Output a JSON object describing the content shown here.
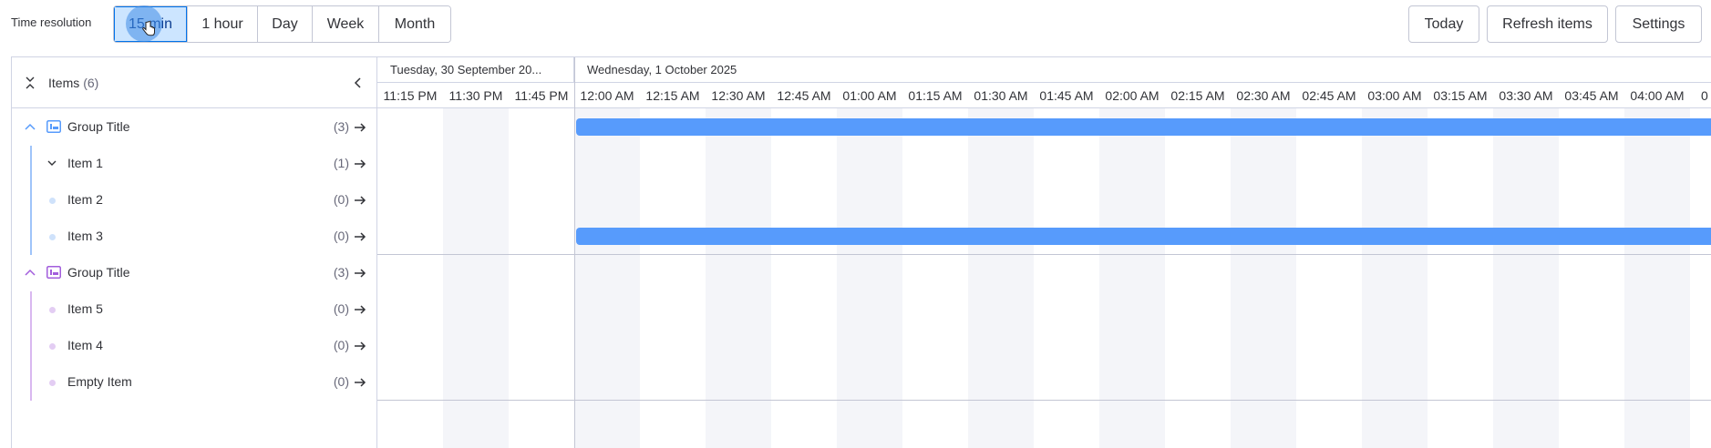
{
  "toolbar": {
    "resolution_label": "Time resolution",
    "resolutions": [
      {
        "label": "15 min",
        "active": true
      },
      {
        "label": "1 hour",
        "active": false
      },
      {
        "label": "Day",
        "active": false
      },
      {
        "label": "Week",
        "active": false
      },
      {
        "label": "Month",
        "active": false
      }
    ],
    "today_label": "Today",
    "refresh_label": "Refresh items",
    "settings_label": "Settings"
  },
  "panel": {
    "items_label": "Items",
    "items_count": "(6)"
  },
  "groups": [
    {
      "title": "Group Title",
      "count": "(3)",
      "color": "#579bfc",
      "items": [
        {
          "name": "Item 1",
          "count": "(1)",
          "expandable": true
        },
        {
          "name": "Item 2",
          "count": "(0)",
          "expandable": false
        },
        {
          "name": "Item 3",
          "count": "(0)",
          "expandable": false
        }
      ]
    },
    {
      "title": "Group Title",
      "count": "(3)",
      "color": "#a25ddc",
      "items": [
        {
          "name": "Item 5",
          "count": "(0)",
          "expandable": false
        },
        {
          "name": "Item 4",
          "count": "(0)",
          "expandable": false
        },
        {
          "name": "Empty Item",
          "count": "(0)",
          "expandable": false
        }
      ]
    }
  ],
  "timeline": {
    "dates": [
      "Tuesday, 30 September 20...",
      "Wednesday, 1 October 2025"
    ],
    "ticks": [
      "11:15 PM",
      "11:30 PM",
      "11:45 PM",
      "12:00 AM",
      "12:15 AM",
      "12:30 AM",
      "12:45 AM",
      "01:00 AM",
      "01:15 AM",
      "01:30 AM",
      "01:45 AM",
      "02:00 AM",
      "02:15 AM",
      "02:30 AM",
      "02:45 AM",
      "03:00 AM",
      "03:15 AM",
      "03:30 AM",
      "03:45 AM",
      "04:00 AM",
      "0"
    ],
    "bar_color": "#579bfc",
    "stripe_color": "#f4f5f9"
  }
}
